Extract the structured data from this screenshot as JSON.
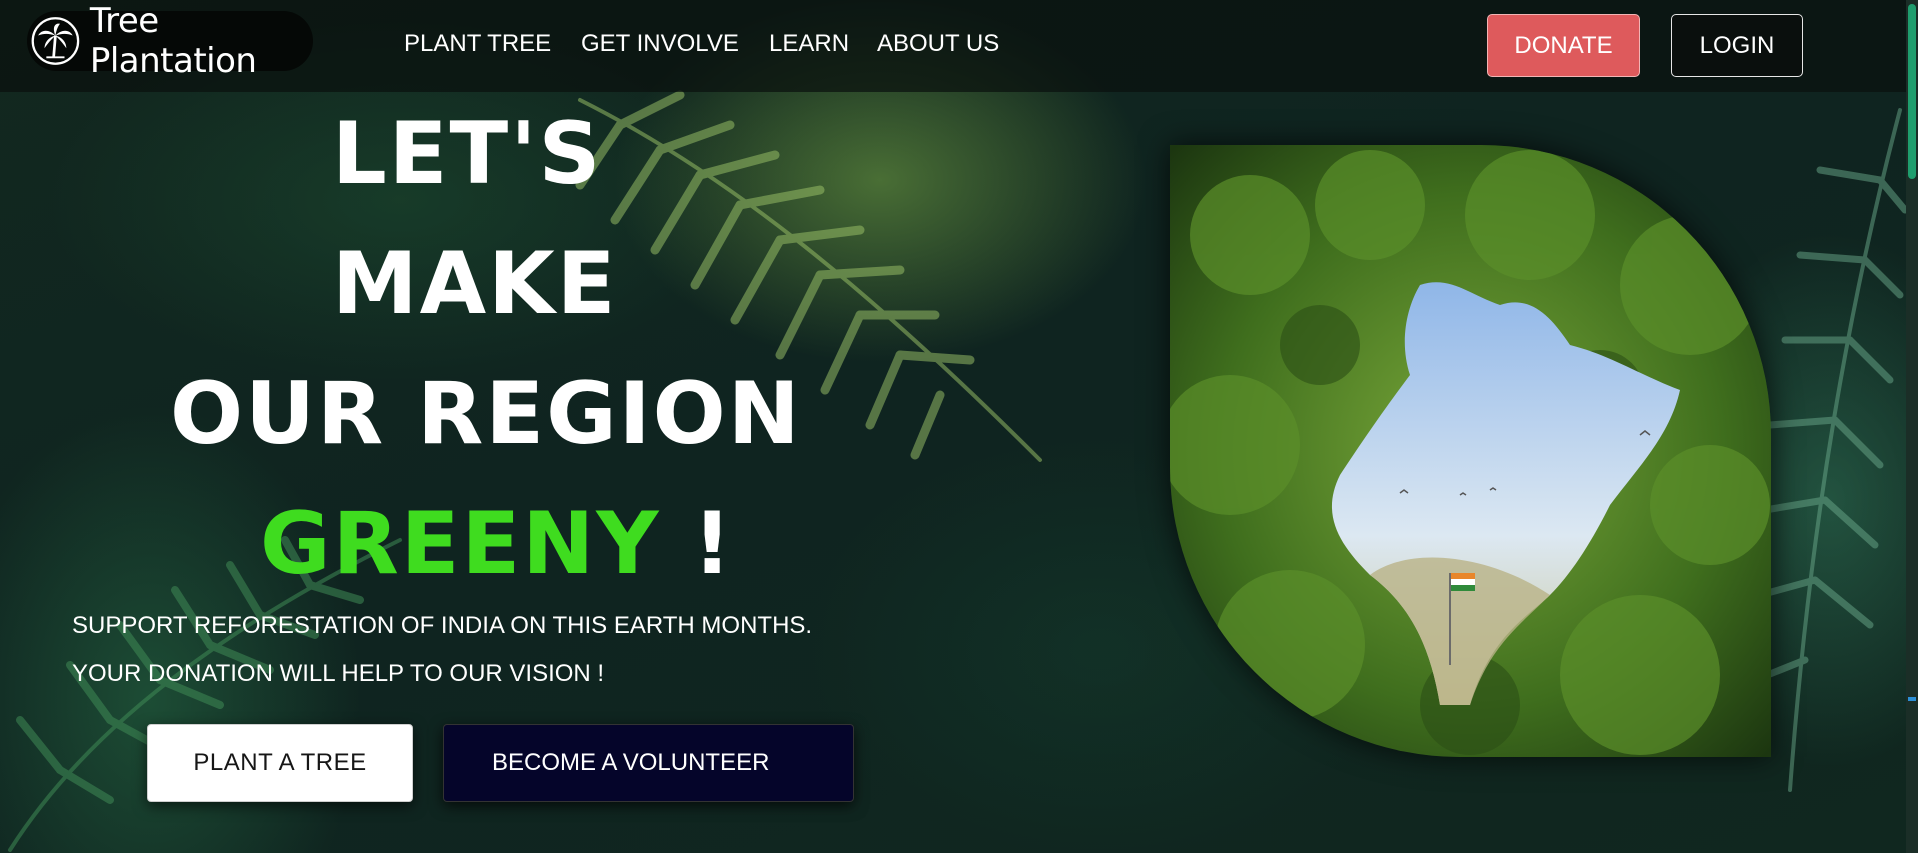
{
  "brand": {
    "name": "Tree Plantation",
    "logo_icon": "palm-tree-icon"
  },
  "nav": {
    "items": [
      "PLANT TREE",
      "GET INVOLVE",
      "LEARN",
      "ABOUT US"
    ]
  },
  "header_actions": {
    "donate_label": "DONATE",
    "login_label": "LOGIN"
  },
  "hero": {
    "line1": "LET'S",
    "line2": "MAKE",
    "line3": "OUR REGION",
    "highlight": "GREENY",
    "exclaim": "!",
    "subtitle1": "SUPPORT REFORESTATION OF INDIA ON THIS EARTH MONTHS.",
    "subtitle2": "YOUR DONATION WILL HELP TO OUR VISION !",
    "primary_button": "PLANT A TREE",
    "secondary_button": "BECOME A VOLUNTEER"
  },
  "colors": {
    "accent_green": "#3fdc1f",
    "donate_red": "#de5a5c",
    "volunteer_navy": "#05052a"
  }
}
